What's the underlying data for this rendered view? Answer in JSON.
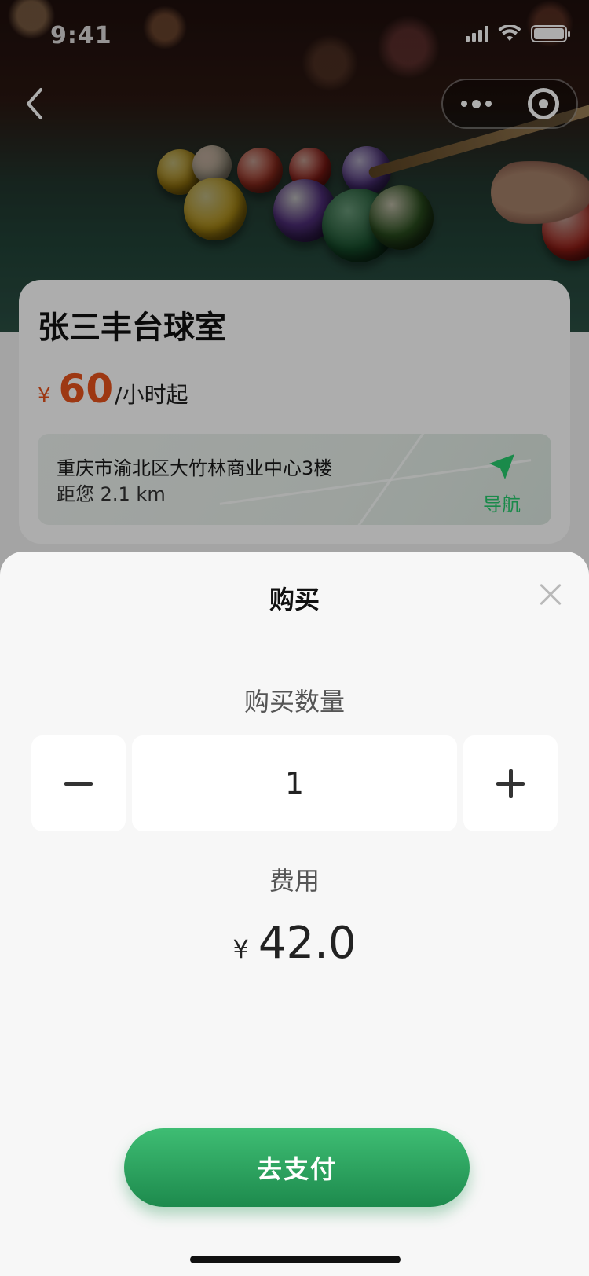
{
  "status_bar": {
    "time": "9:41"
  },
  "venue": {
    "name": "张三丰台球室",
    "price_currency": "¥",
    "price_value": "60",
    "price_unit": "/小时起",
    "address": "重庆市渝北区大竹林商业中心3楼",
    "distance": "距您 2.1 km",
    "navigate_label": "导航"
  },
  "sheet": {
    "title": "购买",
    "quantity_label": "购买数量",
    "quantity_value": "1",
    "fee_label": "费用",
    "fee_currency": "¥",
    "fee_value": "42.0",
    "pay_label": "去支付"
  },
  "icons": {
    "back": "chevron-left-icon",
    "more": "more-dots-icon",
    "close_miniprogram": "target-ring-icon",
    "navigate": "paper-plane-icon",
    "close_sheet": "close-icon",
    "decrease": "minus-icon",
    "increase": "plus-icon"
  },
  "colors": {
    "accent_green": "#1d8a4d",
    "price_orange": "#e8531d"
  }
}
